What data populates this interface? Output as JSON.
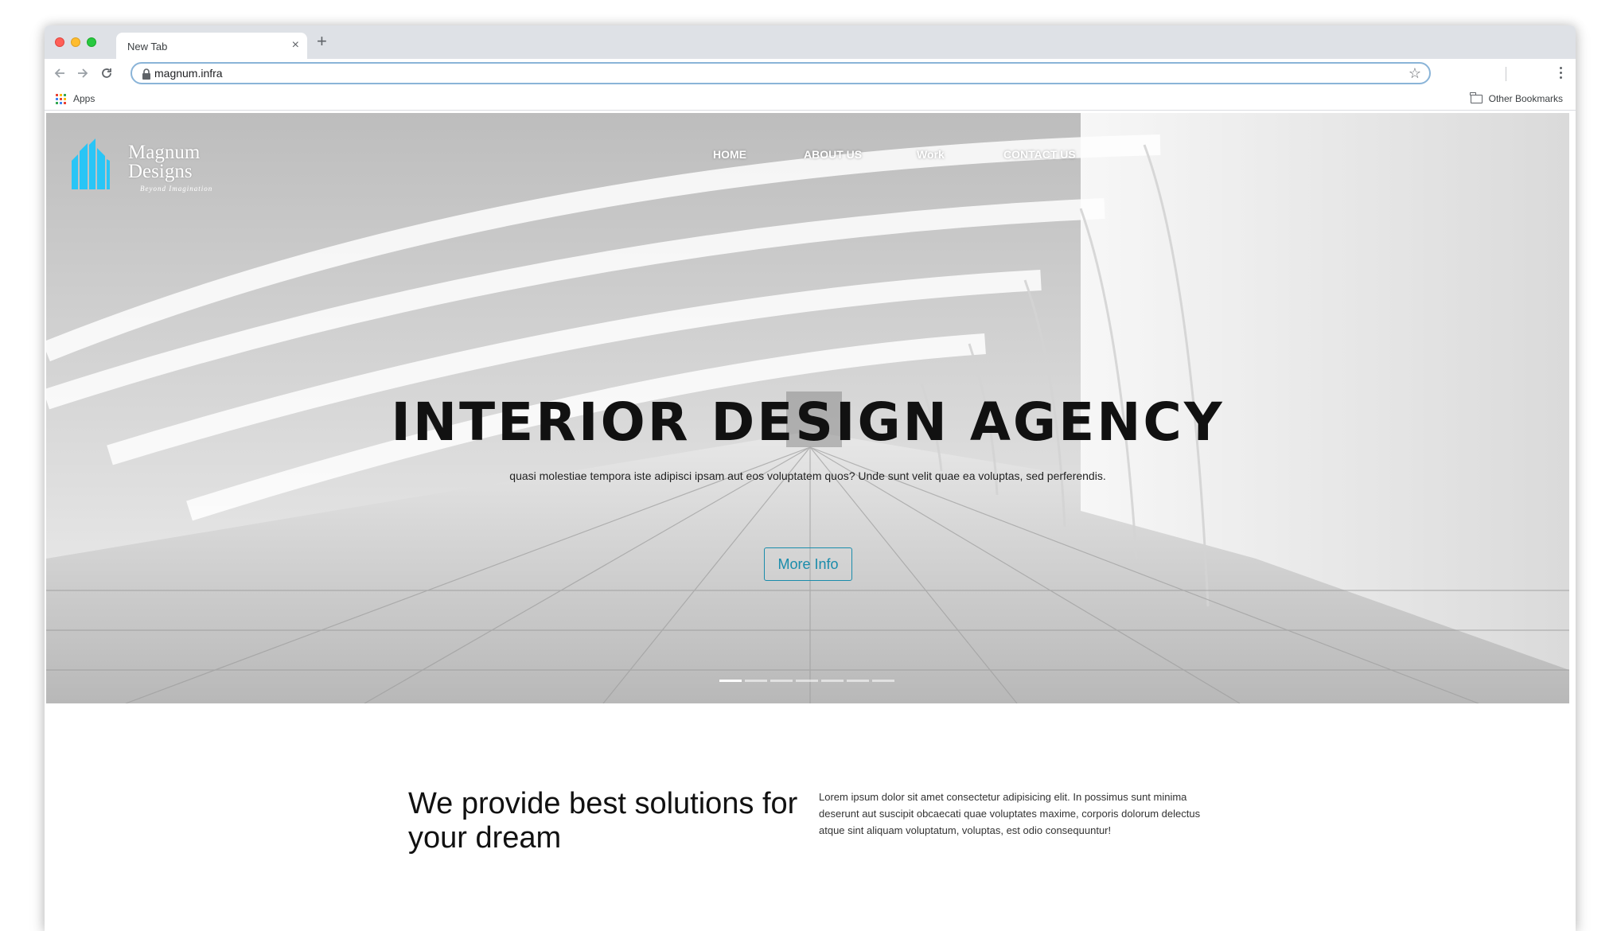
{
  "browser": {
    "tab_title": "New Tab",
    "tab_close": "×",
    "new_tab": "+",
    "url": "magnum.infra",
    "bookmarks": {
      "apps_label": "Apps",
      "other_label": "Other Bookmarks"
    }
  },
  "site": {
    "logo": {
      "line1": "Magnum",
      "line2": "Designs",
      "tagline": "Beyond Imagination"
    },
    "nav": [
      "HOME",
      "ABOUT US",
      "Work",
      "CONTACT US"
    ],
    "hero": {
      "title": "INTERIOR DESIGN AGENCY",
      "subtitle": "quasi molestiae tempora iste adipisci ipsam aut eos voluptatem quos? Unde sunt velit quae ea voluptas, sed perferendis.",
      "button": "More Info",
      "slide_count": 7,
      "active_slide": 1
    },
    "intro": {
      "heading": "We provide best solutions for your dream",
      "text": "Lorem ipsum dolor sit amet consectetur adipisicing elit. In possimus sunt minima deserunt aut suscipit obcaecati quae voluptates maxime, corporis dolorum delectus atque sint aliquam voluptatum, voluptas, est odio consequuntur!"
    }
  },
  "colors": {
    "accent": "#1a8cab",
    "logo_blue": "#29c5f6"
  }
}
